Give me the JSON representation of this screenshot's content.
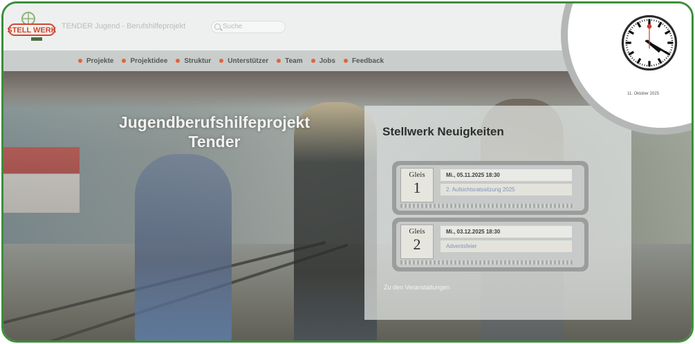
{
  "header": {
    "logo_text": "STELL WERK",
    "site_title": "TENDER Jugend - Berufshilfeprojekt",
    "search_placeholder": "Suche"
  },
  "nav": {
    "items": [
      {
        "label": "Projekte"
      },
      {
        "label": "Projektidee"
      },
      {
        "label": "Struktur"
      },
      {
        "label": "Unterstützer"
      },
      {
        "label": "Team"
      },
      {
        "label": "Jobs"
      },
      {
        "label": "Feedback"
      }
    ]
  },
  "hero": {
    "title_line1": "Jugendberufshilfeprojekt",
    "title_line2": "Tender"
  },
  "news": {
    "title": "Stellwerk Neuigkeiten",
    "entries": [
      {
        "gleis_label": "Gleis",
        "gleis_number": "1",
        "date": "Mi., 05.11.2025 18:30",
        "event": "2. Aufsichtsratssitzung 2025"
      },
      {
        "gleis_label": "Gleis",
        "gleis_number": "2",
        "date": "Mi., 03.12.2025 18:30",
        "event": "Adventsfeier"
      }
    ],
    "all_link": "Zu den Veranstaltungen"
  },
  "clock": {
    "date": "11. Oktober 2025",
    "hour": 4,
    "minute": 20,
    "second": 0
  },
  "colors": {
    "border": "#3a8f3a",
    "nav_dot": "#e0643a",
    "second_hand": "#d9382b"
  }
}
